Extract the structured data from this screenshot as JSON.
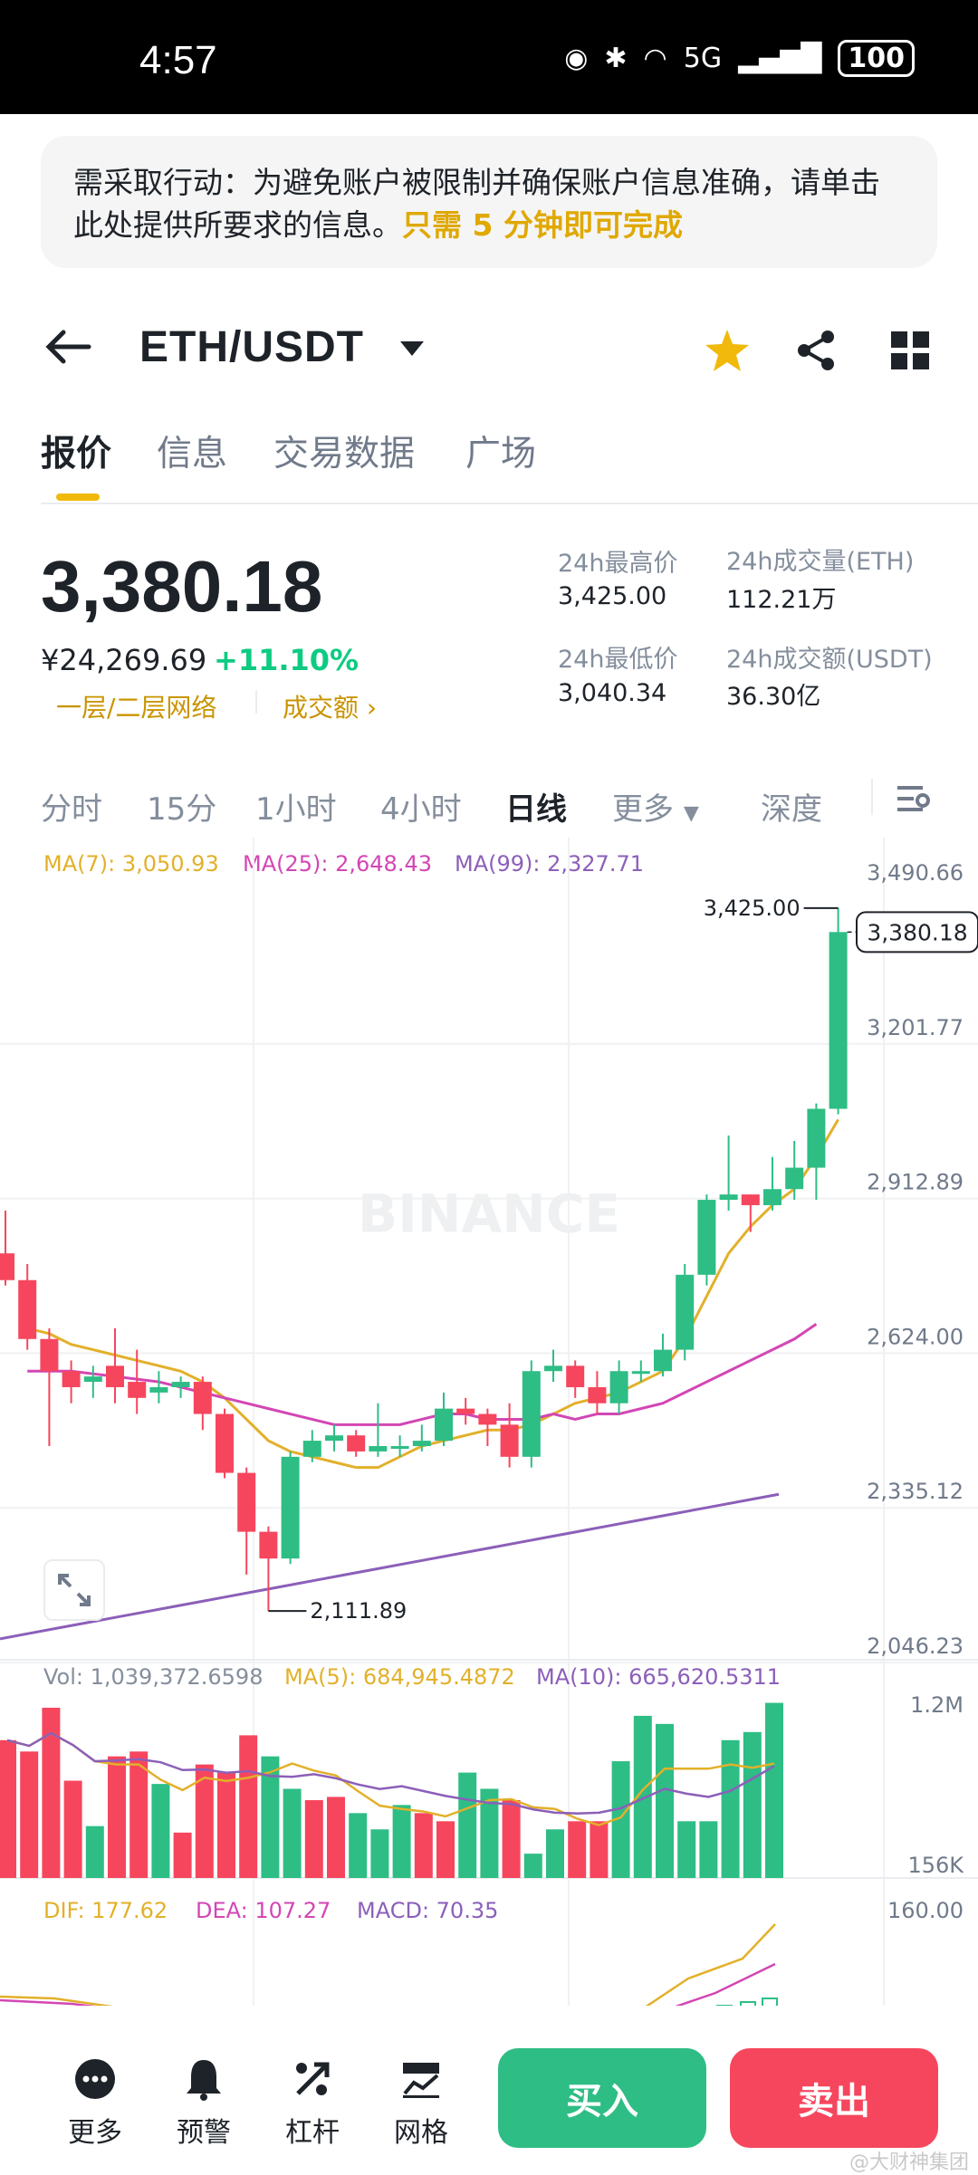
{
  "status_bar": {
    "time": "4:57",
    "signal": "5G",
    "battery": "100"
  },
  "banner": {
    "text": "需采取行动：为避免账户被限制并确保账户信息准确，请单击此处提供所要求的信息。",
    "action": "只需 5 分钟即可完成"
  },
  "header": {
    "pair": "ETH/USDT"
  },
  "tabs": [
    "报价",
    "信息",
    "交易数据",
    "广场"
  ],
  "price": {
    "last": "3,380.18",
    "cny": "¥24,269.69",
    "change": "+11.10%",
    "network": "一层/二层网络",
    "volume_link": "成交额"
  },
  "stats": {
    "high_label": "24h最高价",
    "high_value": "3,425.00",
    "vol_eth_label": "24h成交量(ETH)",
    "vol_eth_value": "112.21万",
    "low_label": "24h最低价",
    "low_value": "3,040.34",
    "vol_usdt_label": "24h成交额(USDT)",
    "vol_usdt_value": "36.30亿"
  },
  "intervals": [
    "分时",
    "15分",
    "1小时",
    "4小时",
    "日线",
    "更多",
    "深度"
  ],
  "ma_legend": {
    "ma7": "MA(7): 3,050.93",
    "ma25": "MA(25): 2,648.43",
    "ma99": "MA(99): 2,327.71"
  },
  "vol_legend": {
    "vol": "Vol: 1,039,372.6598",
    "ma5": "MA(5): 684,945.4872",
    "ma10": "MA(10): 665,620.5311"
  },
  "macd_legend": {
    "dif": "DIF: 177.62",
    "dea": "DEA: 107.27",
    "macd": "MACD: 70.35"
  },
  "chart_data": {
    "type": "candlestick",
    "y_axis": [
      "3,490.66",
      "3,201.77",
      "2,912.89",
      "2,624.00",
      "2,335.12",
      "2,046.23"
    ],
    "ylim": [
      2046.23,
      3490.66
    ],
    "current_price_label": "3,380.18",
    "high_label": "3,425.00",
    "low_label": "2,111.89",
    "vol_axis": [
      "1.2M",
      "156K"
    ],
    "macd_axis": [
      "160.00"
    ],
    "watermark": "BINANCE",
    "candles": [
      [
        2780,
        2730,
        2860,
        2720
      ],
      [
        2730,
        2620,
        2760,
        2600
      ],
      [
        2620,
        2560,
        2640,
        2420
      ],
      [
        2560,
        2530,
        2580,
        2500
      ],
      [
        2540,
        2550,
        2570,
        2510
      ],
      [
        2570,
        2530,
        2640,
        2500
      ],
      [
        2540,
        2510,
        2600,
        2480
      ],
      [
        2520,
        2530,
        2560,
        2500
      ],
      [
        2530,
        2540,
        2550,
        2510
      ],
      [
        2540,
        2480,
        2550,
        2450
      ],
      [
        2480,
        2370,
        2490,
        2360
      ],
      [
        2370,
        2260,
        2380,
        2180
      ],
      [
        2260,
        2210,
        2270,
        2111.89
      ],
      [
        2210,
        2400,
        2410,
        2200
      ],
      [
        2400,
        2430,
        2450,
        2390
      ],
      [
        2430,
        2440,
        2460,
        2410
      ],
      [
        2440,
        2410,
        2450,
        2400
      ],
      [
        2410,
        2420,
        2500,
        2400
      ],
      [
        2420,
        2420,
        2440,
        2400
      ],
      [
        2420,
        2430,
        2460,
        2410
      ],
      [
        2430,
        2490,
        2520,
        2420
      ],
      [
        2490,
        2480,
        2510,
        2460
      ],
      [
        2480,
        2460,
        2490,
        2420
      ],
      [
        2460,
        2400,
        2500,
        2380
      ],
      [
        2400,
        2560,
        2580,
        2380
      ],
      [
        2560,
        2570,
        2600,
        2540
      ],
      [
        2570,
        2530,
        2580,
        2510
      ],
      [
        2530,
        2500,
        2560,
        2480
      ],
      [
        2500,
        2560,
        2580,
        2480
      ],
      [
        2560,
        2560,
        2580,
        2540
      ],
      [
        2560,
        2600,
        2630,
        2550
      ],
      [
        2600,
        2740,
        2760,
        2580
      ],
      [
        2740,
        2880,
        2890,
        2720
      ],
      [
        2880,
        2890,
        3000,
        2860
      ],
      [
        2890,
        2870,
        2890,
        2820
      ],
      [
        2870,
        2900,
        2960,
        2860
      ],
      [
        2900,
        2940,
        2990,
        2880
      ],
      [
        2940,
        3050,
        3060,
        2880
      ],
      [
        3050,
        3380.18,
        3425,
        3040
      ]
    ],
    "ma7": [
      2640,
      2630,
      2610,
      2600,
      2590,
      2580,
      2570,
      2560,
      2540,
      2510,
      2470,
      2430,
      2410,
      2400,
      2390,
      2380,
      2380,
      2400,
      2420,
      2430,
      2440,
      2450,
      2450,
      2460,
      2480,
      2500,
      2510,
      2520,
      2540,
      2560,
      2620,
      2700,
      2780,
      2830,
      2870,
      2900,
      2960,
      3030
    ],
    "ma25": [
      2560,
      2560,
      2560,
      2555,
      2550,
      2545,
      2540,
      2530,
      2520,
      2510,
      2500,
      2490,
      2480,
      2470,
      2460,
      2460,
      2460,
      2460,
      2470,
      2480,
      2480,
      2470,
      2470,
      2470,
      2480,
      2470,
      2480,
      2480,
      2490,
      2500,
      2520,
      2540,
      2560,
      2580,
      2600,
      2620,
      2648
    ],
    "ma99": [
      2060,
      2070,
      2080,
      2090,
      2100,
      2110,
      2120,
      2130,
      2140,
      2150,
      2160,
      2170,
      2180,
      2190,
      2200,
      2210,
      2220,
      2230,
      2240,
      2250,
      2260,
      2270,
      2280,
      2290,
      2300,
      2310,
      2320,
      2330
    ],
    "volumes": [
      [
        0.85,
        "r"
      ],
      [
        0.78,
        "r"
      ],
      [
        1.05,
        "r"
      ],
      [
        0.6,
        "r"
      ],
      [
        0.32,
        "g"
      ],
      [
        0.75,
        "r"
      ],
      [
        0.78,
        "r"
      ],
      [
        0.58,
        "g"
      ],
      [
        0.28,
        "r"
      ],
      [
        0.7,
        "r"
      ],
      [
        0.65,
        "r"
      ],
      [
        0.88,
        "r"
      ],
      [
        0.75,
        "g"
      ],
      [
        0.55,
        "g"
      ],
      [
        0.48,
        "r"
      ],
      [
        0.5,
        "r"
      ],
      [
        0.4,
        "g"
      ],
      [
        0.3,
        "g"
      ],
      [
        0.45,
        "g"
      ],
      [
        0.4,
        "r"
      ],
      [
        0.35,
        "r"
      ],
      [
        0.65,
        "g"
      ],
      [
        0.55,
        "g"
      ],
      [
        0.48,
        "r"
      ],
      [
        0.15,
        "g"
      ],
      [
        0.3,
        "g"
      ],
      [
        0.35,
        "r"
      ],
      [
        0.35,
        "r"
      ],
      [
        0.72,
        "g"
      ],
      [
        1.0,
        "g"
      ],
      [
        0.95,
        "g"
      ],
      [
        0.35,
        "g"
      ],
      [
        0.35,
        "g"
      ],
      [
        0.85,
        "g"
      ],
      [
        0.9,
        "g"
      ],
      [
        1.08,
        "g"
      ]
    ]
  },
  "bottom_bar": {
    "more": "更多",
    "alert": "预警",
    "leverage": "杠杆",
    "grid": "网格",
    "buy": "买入",
    "sell": "卖出"
  },
  "credit": "@大财神集团"
}
